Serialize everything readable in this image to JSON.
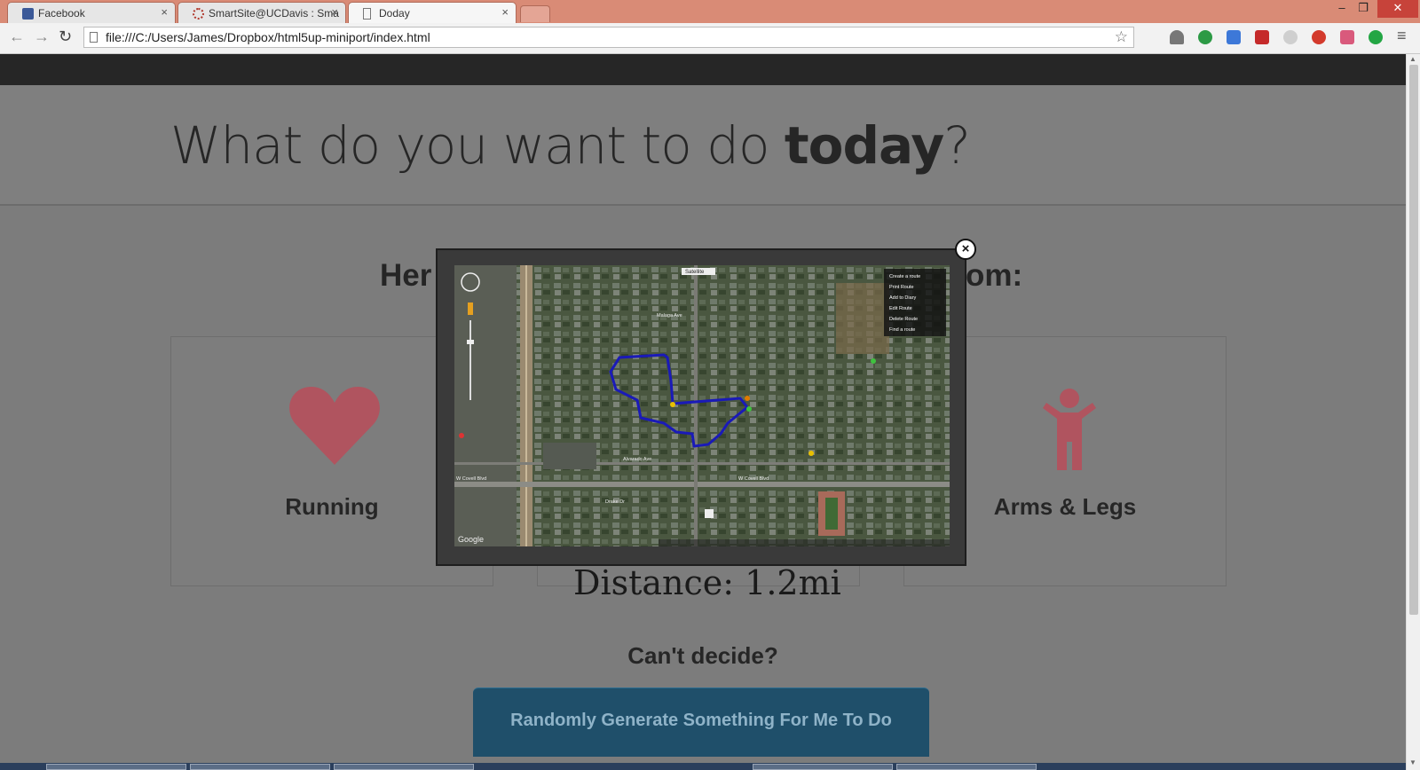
{
  "browser": {
    "tabs": [
      {
        "title": "Facebook",
        "active": false
      },
      {
        "title": "SmartSite@UCDavis : Sma",
        "active": false
      },
      {
        "title": "Doday",
        "active": true
      }
    ],
    "url": "file:///C:/Users/James/Dropbox/html5up-miniport/index.html"
  },
  "page": {
    "hero_title_prefix": "What do you want to do ",
    "hero_title_bold": "today",
    "hero_title_suffix": "?",
    "section_left": "Her",
    "section_right": "om:",
    "cards": [
      {
        "label": "Running",
        "icon": "heart-icon"
      },
      {
        "label": "Arms & Legs",
        "icon": "person-icon"
      }
    ],
    "distance": "Distance: 1.2mi",
    "cant_decide": "Can't decide?",
    "random_button": "Randomly Generate Something For Me To Do"
  },
  "map": {
    "map_type": "Satellite",
    "menu": [
      "Create a route",
      "Print Route",
      "Add to Diary",
      "Edit Route",
      "Delete Route",
      "Find a route"
    ],
    "streets": [
      "Alvarado Ave",
      "W Covell Blvd",
      "W Covell Blvd",
      "Drake Dr",
      "Malaga Ave"
    ],
    "logo": "Google"
  },
  "colors": {
    "heart": "#b0545f",
    "person": "#b0545f",
    "route": "#1a1ab8",
    "button": "#1f4f6a"
  }
}
